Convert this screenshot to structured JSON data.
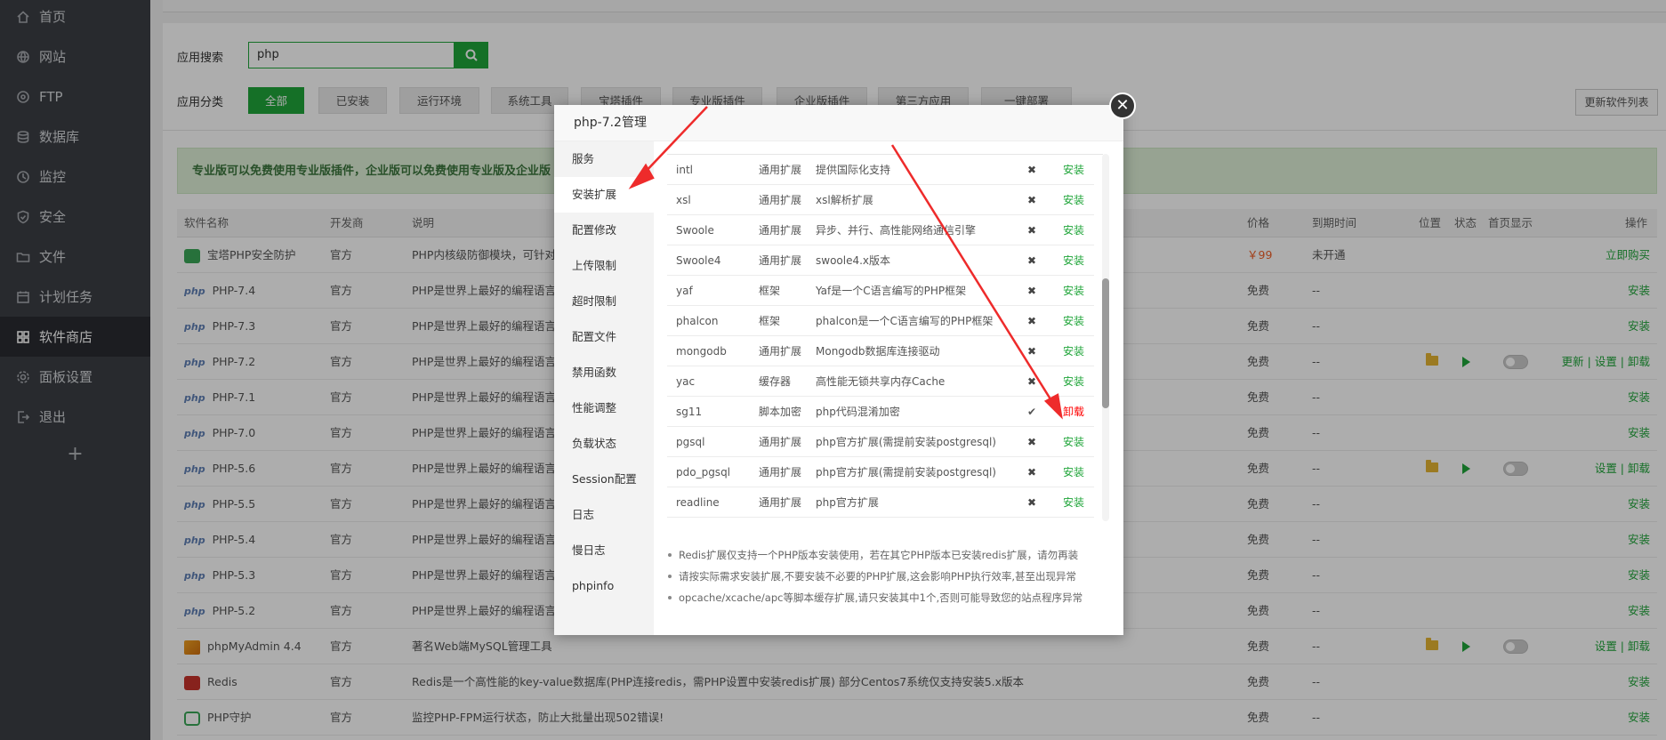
{
  "sidebar": {
    "items": [
      {
        "label": "首页",
        "icon": "home-icon"
      },
      {
        "label": "网站",
        "icon": "globe-icon"
      },
      {
        "label": "FTP",
        "icon": "ftp-icon"
      },
      {
        "label": "数据库",
        "icon": "database-icon"
      },
      {
        "label": "监控",
        "icon": "monitor-icon"
      },
      {
        "label": "安全",
        "icon": "shield-icon"
      },
      {
        "label": "文件",
        "icon": "folder-icon"
      },
      {
        "label": "计划任务",
        "icon": "clock-icon"
      },
      {
        "label": "软件商店",
        "icon": "grid-icon"
      },
      {
        "label": "面板设置",
        "icon": "gear-icon"
      },
      {
        "label": "退出",
        "icon": "logout-icon"
      }
    ],
    "active_index": 8,
    "add_label": "+"
  },
  "search": {
    "label": "应用搜索",
    "value": "php"
  },
  "categories": {
    "label": "应用分类",
    "items": [
      "全部",
      "已安装",
      "运行环境",
      "系统工具",
      "宝塔插件",
      "专业版插件",
      "企业版插件",
      "第三方应用",
      "一键部署"
    ],
    "refresh": "更新软件列表"
  },
  "notice": "专业版可以免费使用专业版插件，企业版可以免费使用专业版及企业版",
  "table": {
    "headers": [
      "软件名称",
      "开发商",
      "说明",
      "价格",
      "到期时间",
      "位置",
      "状态",
      "首页显示",
      "操作"
    ],
    "rows": [
      {
        "name": "宝塔PHP安全防护",
        "dev": "官方",
        "desc": "PHP内核级防御模块，可针对耳",
        "price": "￥99",
        "expire": "未开通",
        "ops": "立即购买"
      },
      {
        "name": "PHP-7.4",
        "dev": "官方",
        "desc": "PHP是世界上最好的编程语言",
        "price": "免费",
        "expire": "--",
        "ops": "安装"
      },
      {
        "name": "PHP-7.3",
        "dev": "官方",
        "desc": "PHP是世界上最好的编程语言",
        "price": "免费",
        "expire": "--",
        "ops": "安装"
      },
      {
        "name": "PHP-7.2",
        "dev": "官方",
        "desc": "PHP是世界上最好的编程语言",
        "price": "免费",
        "expire": "--",
        "ops": "更新 | 设置 | 卸载"
      },
      {
        "name": "PHP-7.1",
        "dev": "官方",
        "desc": "PHP是世界上最好的编程语言",
        "price": "免费",
        "expire": "--",
        "ops": "安装"
      },
      {
        "name": "PHP-7.0",
        "dev": "官方",
        "desc": "PHP是世界上最好的编程语言",
        "price": "免费",
        "expire": "--",
        "ops": "安装"
      },
      {
        "name": "PHP-5.6",
        "dev": "官方",
        "desc": "PHP是世界上最好的编程语言",
        "price": "免费",
        "expire": "--",
        "ops": "设置 | 卸载"
      },
      {
        "name": "PHP-5.5",
        "dev": "官方",
        "desc": "PHP是世界上最好的编程语言",
        "price": "免费",
        "expire": "--",
        "ops": "安装"
      },
      {
        "name": "PHP-5.4",
        "dev": "官方",
        "desc": "PHP是世界上最好的编程语言",
        "price": "免费",
        "expire": "--",
        "ops": "安装"
      },
      {
        "name": "PHP-5.3",
        "dev": "官方",
        "desc": "PHP是世界上最好的编程语言",
        "price": "免费",
        "expire": "--",
        "ops": "安装"
      },
      {
        "name": "PHP-5.2",
        "dev": "官方",
        "desc": "PHP是世界上最好的编程语言",
        "price": "免费",
        "expire": "--",
        "ops": "安装"
      },
      {
        "name": "phpMyAdmin 4.4",
        "dev": "官方",
        "desc": "著名Web端MySQL管理工具",
        "price": "免费",
        "expire": "--",
        "ops": "设置 | 卸载"
      },
      {
        "name": "Redis",
        "dev": "官方",
        "desc": "Redis是一个高性能的key-value数据库(PHP连接redis，需PHP设置中安装redis扩展) 部分Centos7系统仅支持安装5.x版本",
        "price": "免费",
        "expire": "--",
        "ops": "安装"
      },
      {
        "name": "PHP守护",
        "dev": "官方",
        "desc": "监控PHP-FPM运行状态，防止大批量出现502错误!",
        "price": "免费",
        "expire": "--",
        "ops": "安装"
      }
    ]
  },
  "modal": {
    "title": "php-7.2管理",
    "close": "✕",
    "menu": [
      "服务",
      "安装扩展",
      "配置修改",
      "上传限制",
      "超时限制",
      "配置文件",
      "禁用函数",
      "性能调整",
      "负载状态",
      "Session配置",
      "日志",
      "慢日志",
      "phpinfo"
    ],
    "active_menu": 1,
    "extensions": [
      {
        "name": "intl",
        "type": "通用扩展",
        "desc": "提供国际化支持",
        "status": "✖",
        "action": "安装"
      },
      {
        "name": "xsl",
        "type": "通用扩展",
        "desc": "xsl解析扩展",
        "status": "✖",
        "action": "安装"
      },
      {
        "name": "Swoole",
        "type": "通用扩展",
        "desc": "异步、并行、高性能网络通信引擎",
        "status": "✖",
        "action": "安装"
      },
      {
        "name": "Swoole4",
        "type": "通用扩展",
        "desc": "swoole4.x版本",
        "status": "✖",
        "action": "安装"
      },
      {
        "name": "yaf",
        "type": "框架",
        "desc": "Yaf是一个C语言编写的PHP框架",
        "status": "✖",
        "action": "安装"
      },
      {
        "name": "phalcon",
        "type": "框架",
        "desc": "phalcon是一个C语言编写的PHP框架",
        "status": "✖",
        "action": "安装"
      },
      {
        "name": "mongodb",
        "type": "通用扩展",
        "desc": "Mongodb数据库连接驱动",
        "status": "✖",
        "action": "安装"
      },
      {
        "name": "yac",
        "type": "缓存器",
        "desc": "高性能无锁共享内存Cache",
        "status": "✖",
        "action": "安装"
      },
      {
        "name": "sg11",
        "type": "脚本加密",
        "desc": "php代码混淆加密",
        "status": "✔",
        "action": "卸载"
      },
      {
        "name": "pgsql",
        "type": "通用扩展",
        "desc": "php官方扩展(需提前安装postgresql)",
        "status": "✖",
        "action": "安装"
      },
      {
        "name": "pdo_pgsql",
        "type": "通用扩展",
        "desc": "php官方扩展(需提前安装postgresql)",
        "status": "✖",
        "action": "安装"
      },
      {
        "name": "readline",
        "type": "通用扩展",
        "desc": "php官方扩展",
        "status": "✖",
        "action": "安装"
      }
    ],
    "tips": [
      "Redis扩展仅支持一个PHP版本安装使用，若在其它PHP版本已安装redis扩展，请勿再装",
      "请按实际需求安装扩展,不要安装不必要的PHP扩展,这会影响PHP执行效率,甚至出现异常",
      "opcache/xcache/apc等脚本缓存扩展,请只安装其中1个,否则可能导致您的站点程序异常"
    ]
  },
  "colors": {
    "accent": "#20a53a",
    "danger": "#ff0000",
    "sidebar": "#3b3e44",
    "arrow": "#ee2b2b"
  }
}
